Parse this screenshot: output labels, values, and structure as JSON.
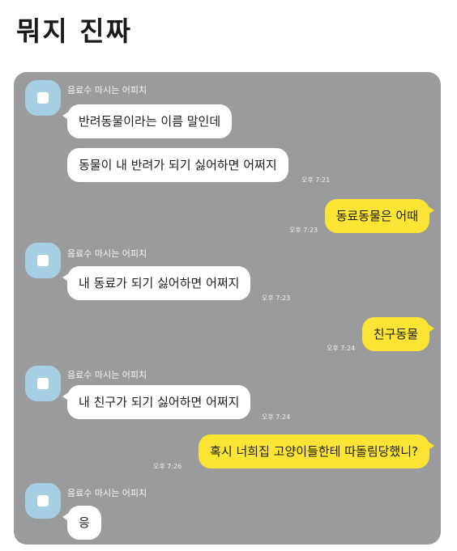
{
  "page": {
    "title": "뭐지 진짜"
  },
  "colors": {
    "chat_background": "#9a9b9c",
    "incoming_bubble": "#ffffff",
    "outgoing_bubble": "#fbe434",
    "avatar": "#a7cfe3"
  },
  "chat": {
    "sender_name": "음료수 마시는 어피치",
    "messages": [
      {
        "direction": "incoming",
        "text": "반려동물이라는 이름 말인데",
        "time": ""
      },
      {
        "direction": "incoming",
        "text": "동물이 내 반려가 되기 싫어하면 어쩌지",
        "time": "오후 7:21"
      },
      {
        "direction": "outgoing",
        "text": "동료동물은 어때",
        "time": "오후 7:23"
      },
      {
        "direction": "incoming",
        "text": "내 동료가 되기 싫어하면 어쩌지",
        "time": "오후 7:23"
      },
      {
        "direction": "outgoing",
        "text": "친구동물",
        "time": "오후 7:24"
      },
      {
        "direction": "incoming",
        "text": "내 친구가 되기 싫어하면 어쩌지",
        "time": "오후 7:24"
      },
      {
        "direction": "outgoing",
        "text": "혹시 너희집 고양이들한테 따돌림당했니?",
        "time": "오후 7:26"
      },
      {
        "direction": "incoming",
        "text": "응",
        "time": ""
      }
    ]
  }
}
